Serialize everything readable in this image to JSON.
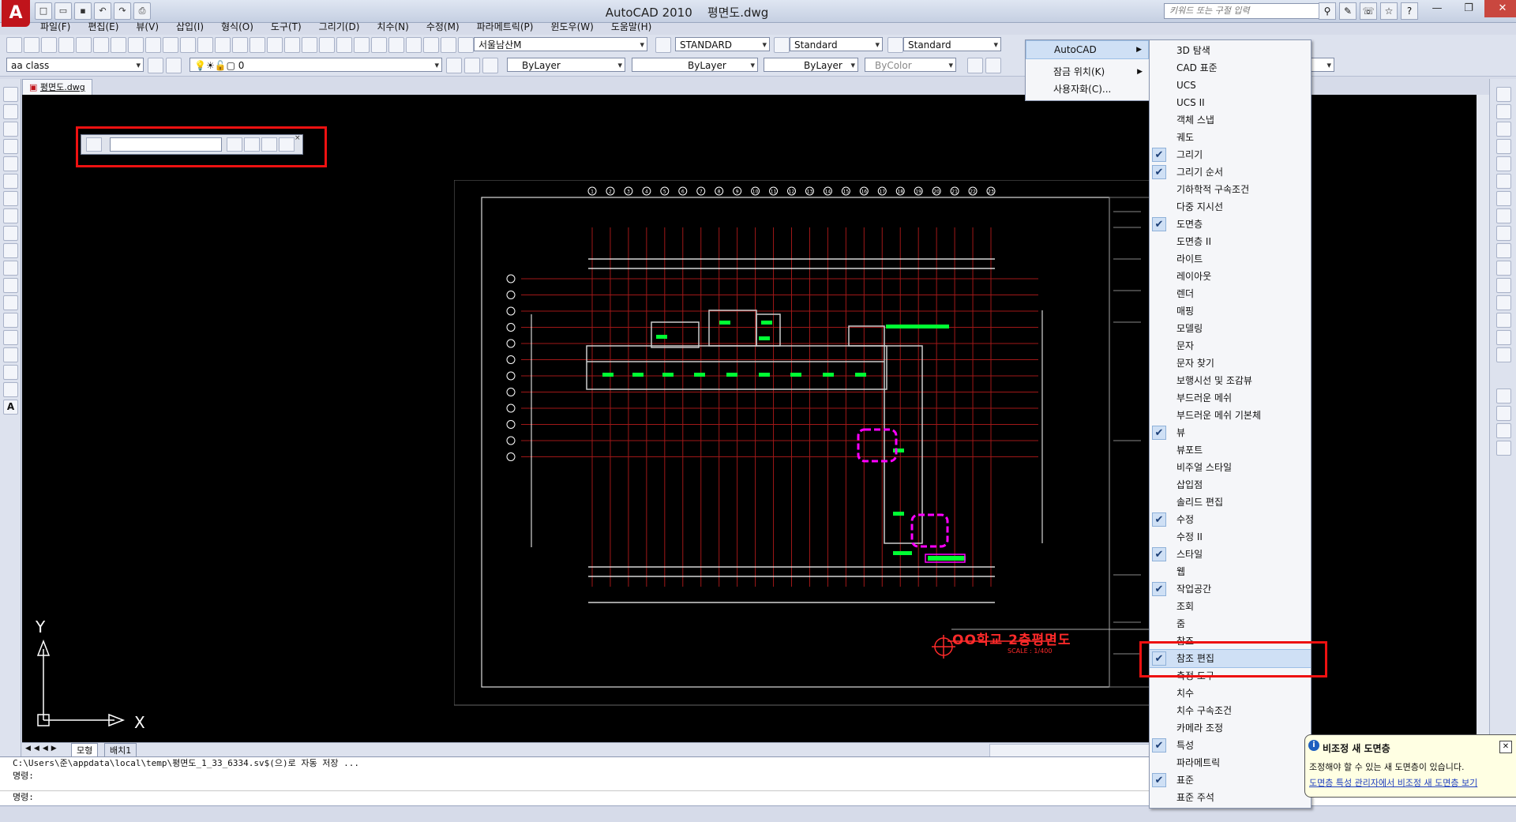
{
  "window": {
    "app_title": "AutoCAD 2010",
    "doc_title": "평면도.dwg",
    "search_placeholder": "키워드 또는 구절 입력",
    "controls": [
      "—",
      "❐",
      "✕"
    ]
  },
  "menubar": [
    "파일(F)",
    "편집(E)",
    "뷰(V)",
    "삽입(I)",
    "형식(O)",
    "도구(T)",
    "그리기(D)",
    "치수(N)",
    "수정(M)",
    "파라메트릭(P)",
    "윈도우(W)",
    "도움말(H)"
  ],
  "toolbar1": {
    "text_style": "서울남산M",
    "dim_style": "STANDARD",
    "table_style": "Standard",
    "mleader_style": "Standard"
  },
  "toolbar2": {
    "workspace": "aa class",
    "layer": "0",
    "color": "ByLayer",
    "linetype": "ByLayer",
    "lineweight": "ByLayer",
    "plotstyle": "ByColor"
  },
  "document_tab": "평면도.dwg",
  "drawing": {
    "title": "OO학교 2층평면도",
    "scale": "SCALE : 1/400",
    "grid_top_labels": [
      "1",
      "2",
      "3",
      "4",
      "5",
      "6",
      "7",
      "8",
      "9",
      "10",
      "11",
      "12",
      "13",
      "14",
      "15",
      "16",
      "17",
      "18",
      "19",
      "20",
      "21",
      "22",
      "23"
    ],
    "ucs": {
      "x": "X",
      "y": "Y"
    }
  },
  "layout_tabs": {
    "model": "모형",
    "layout1": "배치1"
  },
  "command_line": {
    "line1": "C:\\Users\\준\\appdata\\local\\temp\\평면도_1_33_6334.sv$(으)로 자동 저장 ...",
    "line2": "명령:",
    "line3": "명령:"
  },
  "toolbar_menu": {
    "items": [
      {
        "label": "AutoCAD",
        "has_submenu": true,
        "highlighted": true
      },
      {
        "label": "잠금 위치(K)",
        "has_submenu": true,
        "highlighted": false
      },
      {
        "label": "사용자화(C)...",
        "has_submenu": false,
        "highlighted": false
      }
    ]
  },
  "toolbar_submenu": {
    "items": [
      {
        "label": "3D 탐색",
        "checked": false
      },
      {
        "label": "CAD 표준",
        "checked": false
      },
      {
        "label": "UCS",
        "checked": false
      },
      {
        "label": "UCS II",
        "checked": false
      },
      {
        "label": "객체 스냅",
        "checked": false
      },
      {
        "label": "궤도",
        "checked": false
      },
      {
        "label": "그리기",
        "checked": true
      },
      {
        "label": "그리기 순서",
        "checked": true
      },
      {
        "label": "기하학적 구속조건",
        "checked": false
      },
      {
        "label": "다중 지시선",
        "checked": false
      },
      {
        "label": "도면층",
        "checked": true
      },
      {
        "label": "도면층 II",
        "checked": false
      },
      {
        "label": "라이트",
        "checked": false
      },
      {
        "label": "레이아웃",
        "checked": false
      },
      {
        "label": "렌더",
        "checked": false
      },
      {
        "label": "매핑",
        "checked": false
      },
      {
        "label": "모델링",
        "checked": false
      },
      {
        "label": "문자",
        "checked": false
      },
      {
        "label": "문자 찾기",
        "checked": false
      },
      {
        "label": "보행시선 및 조감뷰",
        "checked": false
      },
      {
        "label": "부드러운 메쉬",
        "checked": false
      },
      {
        "label": "부드러운 메쉬 기본체",
        "checked": false
      },
      {
        "label": "뷰",
        "checked": true
      },
      {
        "label": "뷰포트",
        "checked": false
      },
      {
        "label": "비주얼 스타일",
        "checked": false
      },
      {
        "label": "삽입점",
        "checked": false
      },
      {
        "label": "솔리드 편집",
        "checked": false
      },
      {
        "label": "수정",
        "checked": true
      },
      {
        "label": "수정 II",
        "checked": false
      },
      {
        "label": "스타일",
        "checked": true
      },
      {
        "label": "웹",
        "checked": false
      },
      {
        "label": "작업공간",
        "checked": true
      },
      {
        "label": "조회",
        "checked": false
      },
      {
        "label": "줌",
        "checked": false
      },
      {
        "label": "참조",
        "checked": false
      },
      {
        "label": "참조 편집",
        "checked": true,
        "highlighted": true
      },
      {
        "label": "측정 도구",
        "checked": false
      },
      {
        "label": "치수",
        "checked": false
      },
      {
        "label": "치수 구속조건",
        "checked": false
      },
      {
        "label": "카메라 조정",
        "checked": false
      },
      {
        "label": "특성",
        "checked": true
      },
      {
        "label": "파라메트릭",
        "checked": false
      },
      {
        "label": "표준",
        "checked": true
      },
      {
        "label": "표준 주석",
        "checked": false
      }
    ]
  },
  "notification": {
    "title": "비조정 새 도면층",
    "message": "조정해야 할 수 있는 새 도면층이 있습니다.",
    "link": "도면층 특성 관리자에서 비조정 새 도면층 보기"
  },
  "colors": {
    "canvas": "#000000",
    "highlight_box": "#ee1111",
    "drawing_lines": "#ffffff",
    "grid_red": "#a01818",
    "room_green": "#00ff33",
    "magenta": "#ff00ff",
    "title_red": "#ff2a2a"
  }
}
